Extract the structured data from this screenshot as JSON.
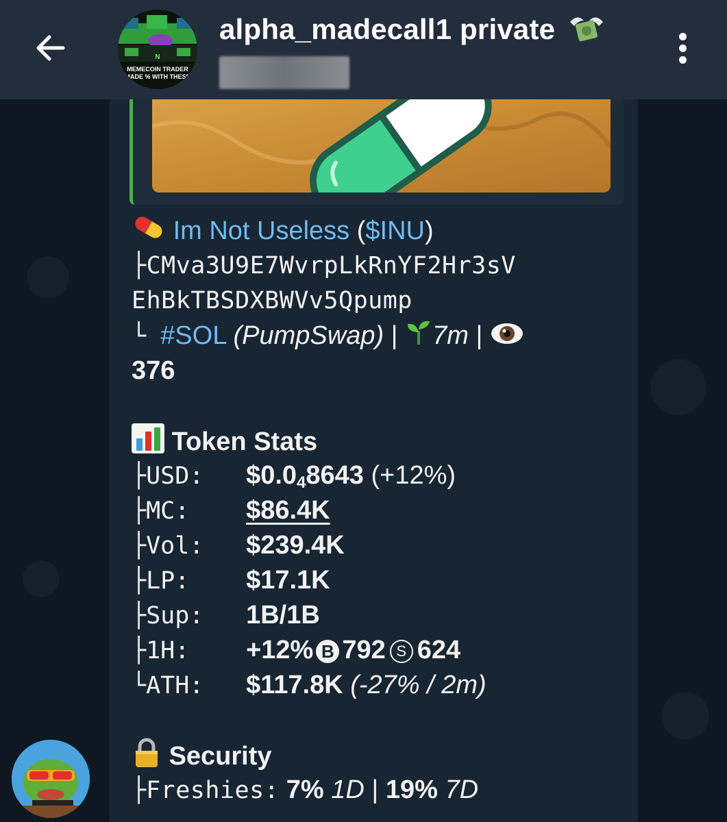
{
  "header": {
    "title": "alpha_madecall1 private",
    "avatar_text": "MEMECOIN TRADER MADE % WITH THESE"
  },
  "message": {
    "token_name": "Im Not Useless",
    "token_ticker_prefix": " (",
    "token_ticker": "$INU",
    "token_ticker_suffix": ")",
    "address_line1": "CMva3U9E7WvrpLkRnYF2Hr3sV",
    "address_line2": "EhBkTBSDXBWVv5Qpump",
    "chain_tag": "#SOL",
    "dex": "(PumpSwap)",
    "separator": " | ",
    "age": "7m",
    "views": "376",
    "stats_title": "Token Stats",
    "stats": {
      "usd_label": "USD:",
      "usd_value_a": "$0.0",
      "usd_value_sub": "4",
      "usd_value_b": "8643",
      "usd_change": " (+12%)",
      "mc_label": "MC:",
      "mc_value": "$86.4K",
      "vol_label": "Vol:",
      "vol_value": "$239.4K",
      "lp_label": "LP:",
      "lp_value": "$17.1K",
      "sup_label": "Sup:",
      "sup_value": "1B/1B",
      "h1_label": "1H:",
      "h1_change": "+12%",
      "h1_buy_icon": "B",
      "h1_buys": "792",
      "h1_sell_icon": "S",
      "h1_sells": "624",
      "ath_label": "ATH:",
      "ath_value": "$117.8K",
      "ath_detail": " (-27% / 2m)"
    },
    "security_title": "Security",
    "security": {
      "freshies_label": "Freshies:",
      "freshies_1d": "7%",
      "freshies_1d_unit": " 1D",
      "freshies_sep": " | ",
      "freshies_7d": "19%",
      "freshies_7d_unit": " 7D"
    }
  },
  "icons": {
    "back": "arrow-left",
    "menu": "vertical-dots",
    "pill": "pill-emoji",
    "seedling": "seedling-emoji",
    "eye": "eye-emoji",
    "chart": "bar-chart-emoji",
    "lock": "lock-emoji",
    "money": "money-with-wings-emoji"
  },
  "colors": {
    "header_bg": "#232e3c",
    "bubble_bg": "#182533",
    "link": "#71baf2",
    "reply_accent": "#4fae4e"
  }
}
